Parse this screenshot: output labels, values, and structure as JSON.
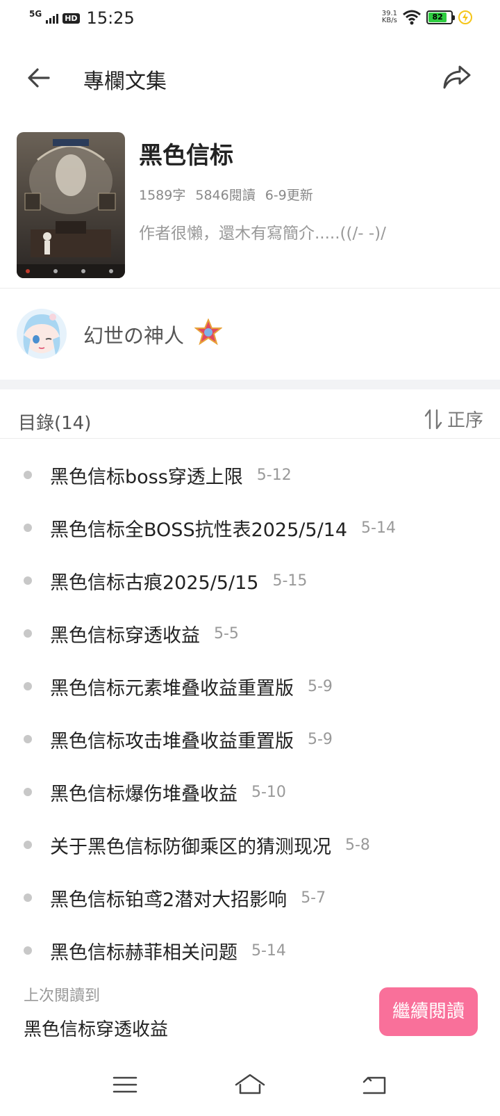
{
  "status_bar": {
    "network": "5G",
    "hd": "HD",
    "time": "15:25",
    "net_speed_value": "39.1",
    "net_speed_unit": "KB/s",
    "battery": "82"
  },
  "header": {
    "title": "專欄文集"
  },
  "book": {
    "title": "黑色信标",
    "word_count": "1589字",
    "reads": "5846閱讀",
    "updated": "6-9更新",
    "description": "作者很懶，還木有寫簡介.....((/- -)/"
  },
  "author": {
    "name": "幻世の神人"
  },
  "toc": {
    "title": "目錄(14)",
    "sort_label": "正序",
    "items": [
      {
        "name": "黑色信标boss穿透上限",
        "date": "5-12"
      },
      {
        "name": "黑色信标全BOSS抗性表2025/5/14",
        "date": "5-14"
      },
      {
        "name": "黑色信标古痕2025/5/15",
        "date": "5-15"
      },
      {
        "name": "黑色信标穿透收益",
        "date": "5-5"
      },
      {
        "name": "黑色信标元素堆叠收益重置版",
        "date": "5-9"
      },
      {
        "name": "黑色信标攻击堆叠收益重置版",
        "date": "5-9"
      },
      {
        "name": "黑色信标爆伤堆叠收益",
        "date": "5-10"
      },
      {
        "name": "关于黑色信标防御乘区的猜测现况",
        "date": "5-8"
      },
      {
        "name": "黑色信标铂鸢2潜对大招影响",
        "date": "5-7"
      },
      {
        "name": "黑色信标赫菲相关问题",
        "date": "5-14"
      }
    ]
  },
  "resume": {
    "label": "上次閱讀到",
    "title": "黑色信标穿透收益",
    "button": "繼續閱讀"
  },
  "colors": {
    "accent": "#f9709a",
    "battery": "#2ecc40",
    "charge": "#f5c518"
  }
}
